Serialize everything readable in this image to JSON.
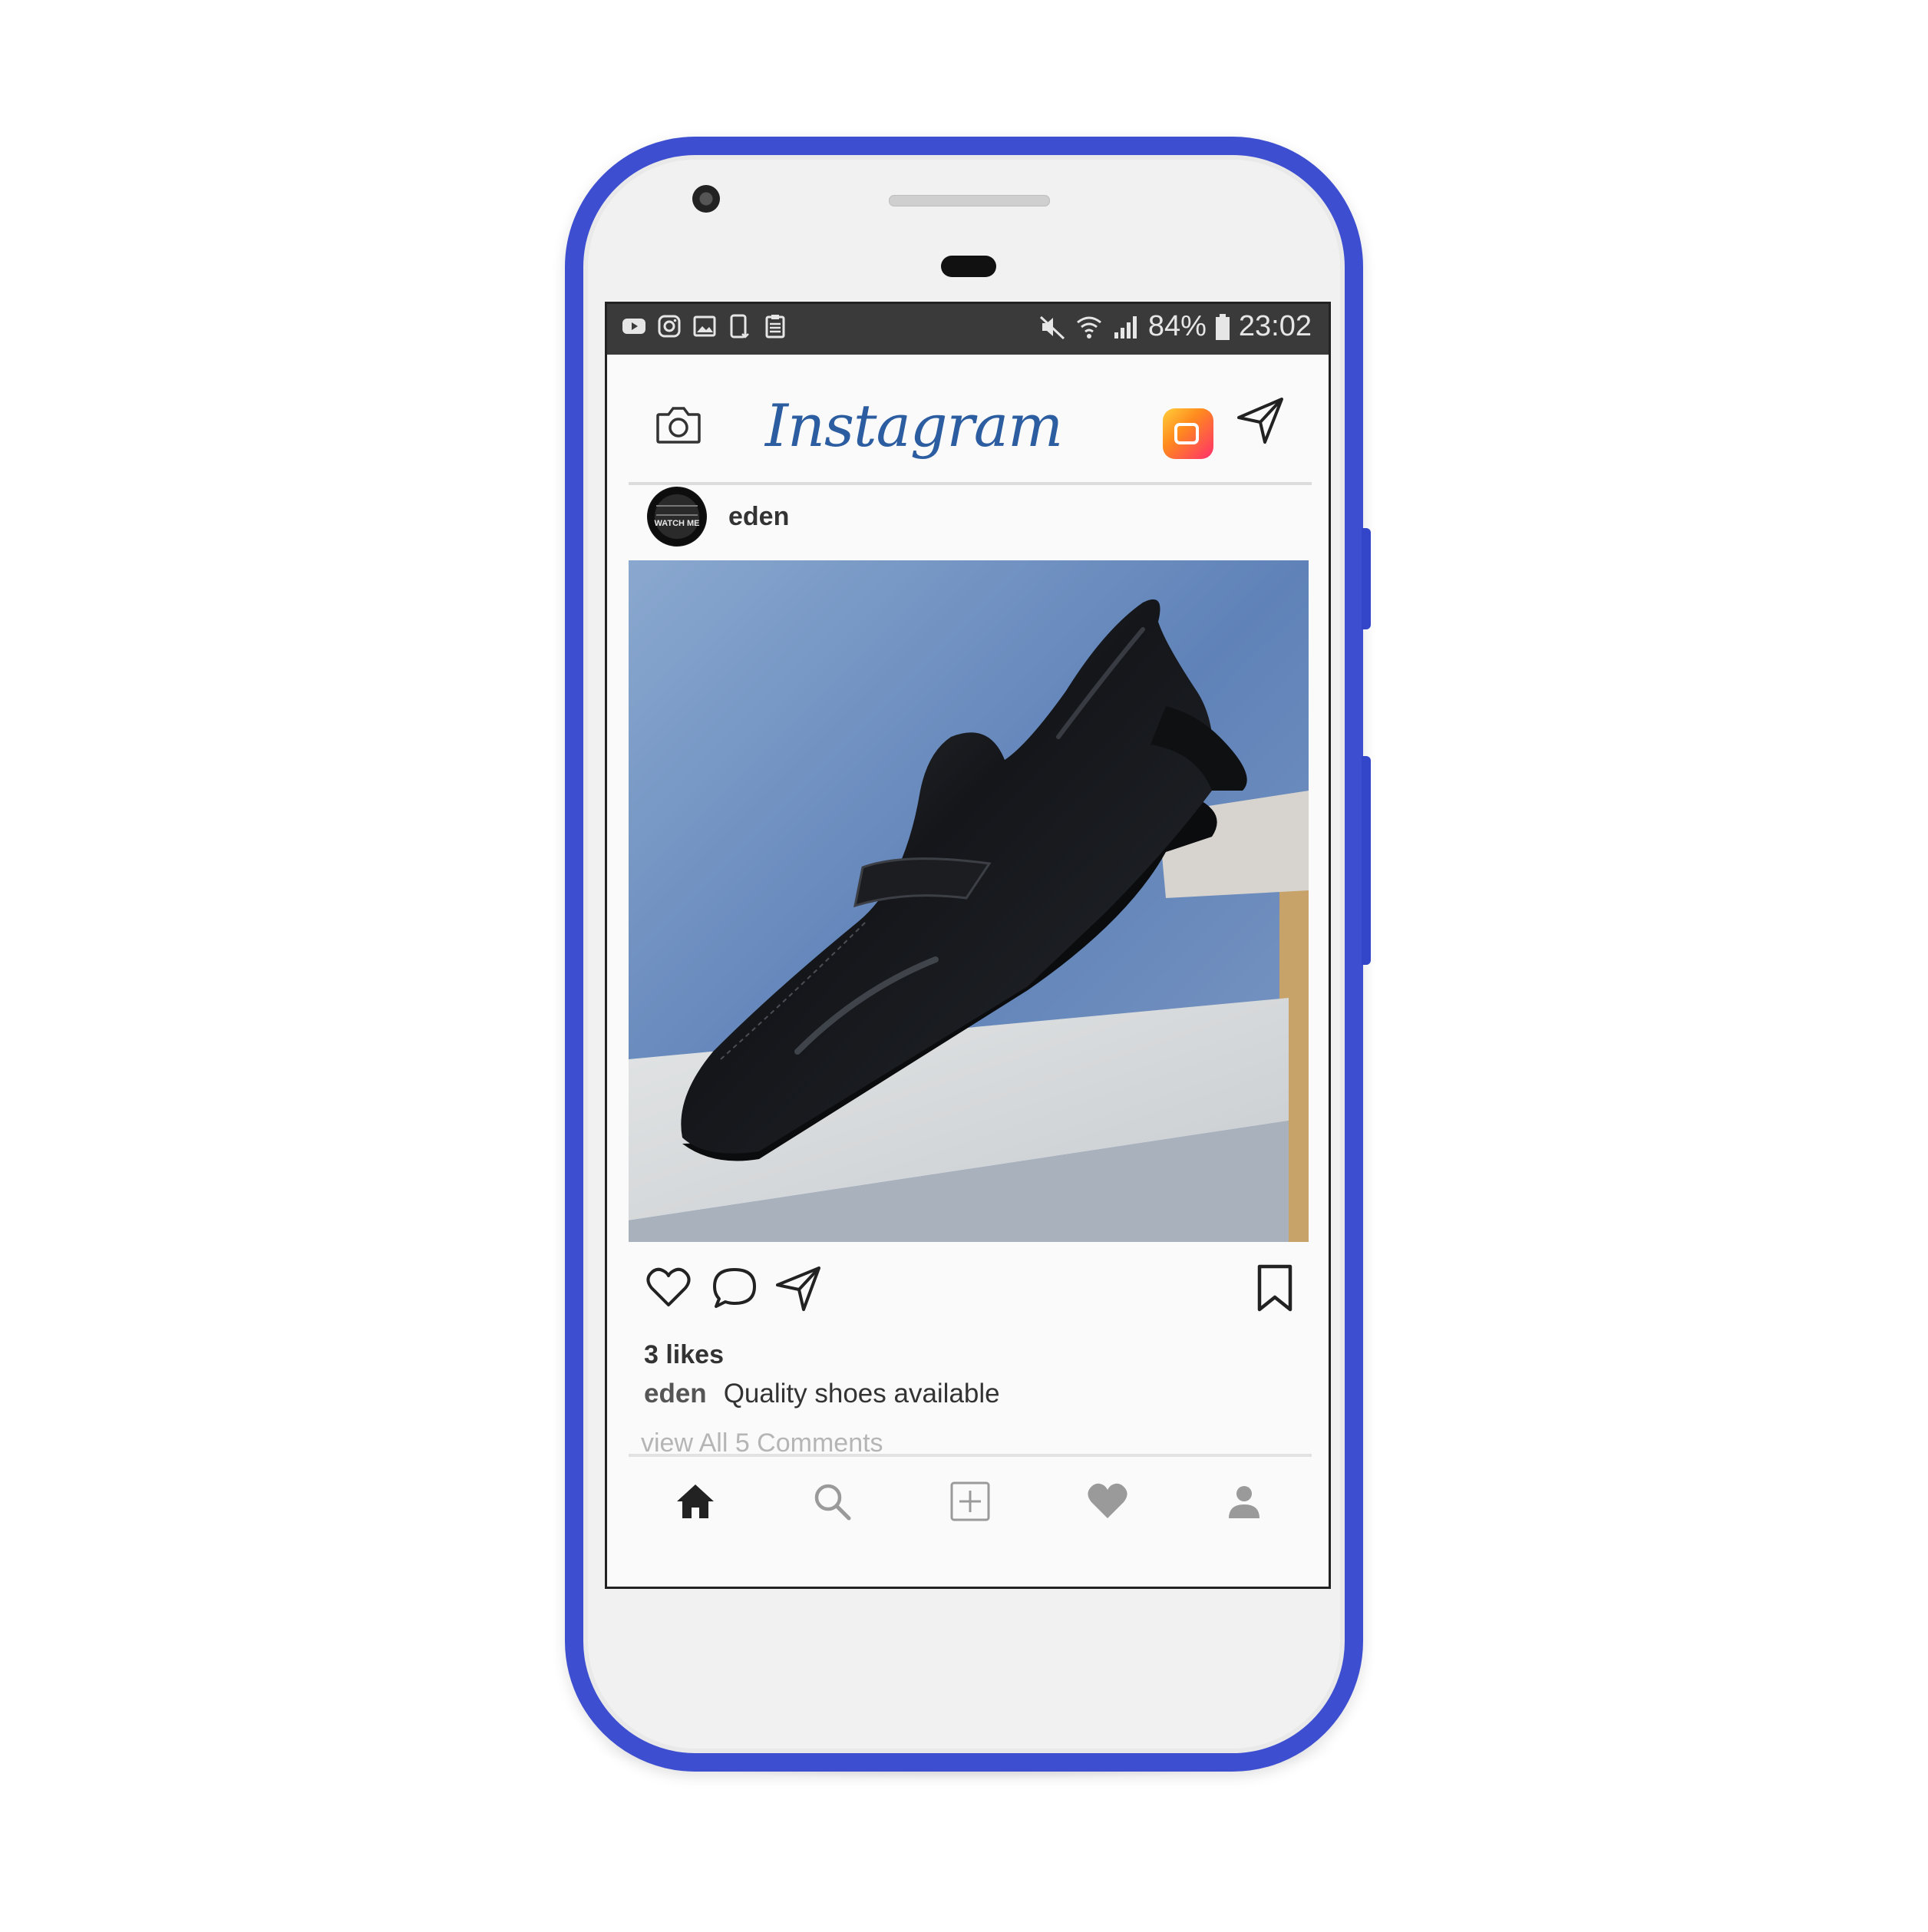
{
  "status_bar": {
    "left_icons": [
      "youtube-icon",
      "instagram-icon",
      "gallery-icon",
      "phone-download-icon",
      "clipboard-icon"
    ],
    "right_icons": [
      "mute-icon",
      "wifi-icon",
      "signal-icon",
      "battery-icon"
    ],
    "battery": "84%",
    "time": "23:02"
  },
  "header": {
    "brand": "Instagram",
    "icons": [
      "camera-icon",
      "igtv-icon",
      "direct-message-icon"
    ]
  },
  "post": {
    "username": "eden",
    "avatar_text": "WATCH ME",
    "image_subject": "black leather penny loafer",
    "likes": "3 likes",
    "caption_user": "eden",
    "caption_text": "Quality shoes available",
    "comments_link": "view All 5 Comments",
    "action_icons": [
      "heart-icon",
      "comment-icon",
      "share-icon",
      "bookmark-icon"
    ]
  },
  "bottom_nav": {
    "items": [
      "home-icon",
      "search-icon",
      "add-post-icon",
      "activity-heart-icon",
      "profile-icon"
    ],
    "active": "home-icon"
  },
  "colors": {
    "phone_frame": "#3d4fd0",
    "brand_text": "#2b5da0",
    "status_bar": "#3a3a3a",
    "photo_background": "#6e8fbf"
  }
}
